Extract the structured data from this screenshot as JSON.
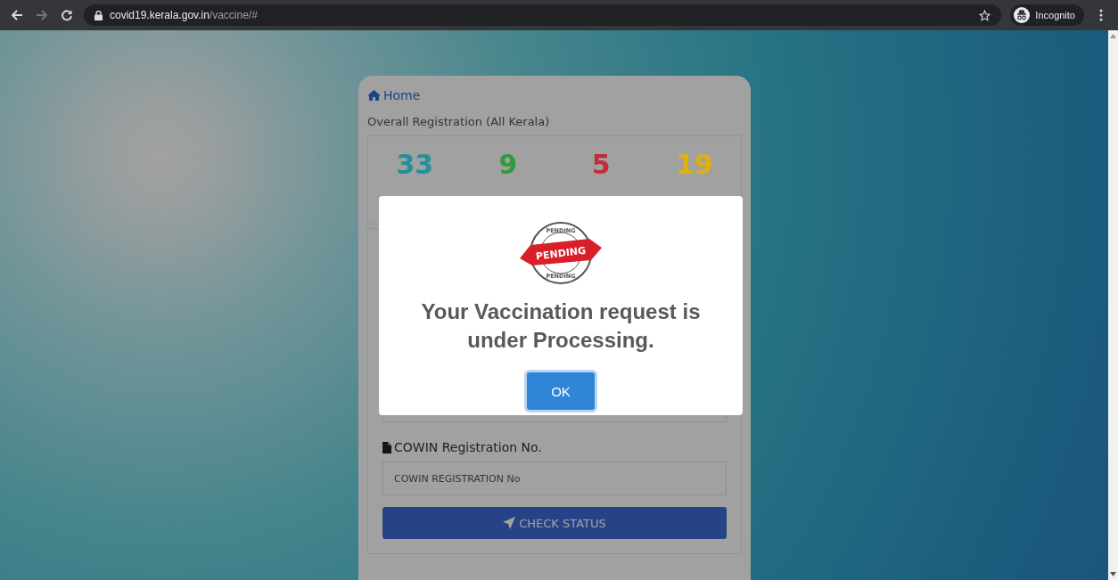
{
  "browser": {
    "url_host": "covid19.kerala.gov.in",
    "url_path": "/vaccine/#",
    "profile_label": "Incognito",
    "forward_disabled": true
  },
  "card": {
    "home_link": "Home",
    "section_title": "Overall Registration (All Kerala)",
    "stats": [
      {
        "value": "33",
        "color": "#23909a"
      },
      {
        "value": "9",
        "color": "#2f9b3b"
      },
      {
        "value": "5",
        "color": "#c22b3a"
      },
      {
        "value": "19",
        "color": "#e0b00e"
      }
    ],
    "field_label": "COWIN Registration No.",
    "field_placeholder": "COWIN REGISTRATION No",
    "submit_button": "CHECK STATUS"
  },
  "dialog": {
    "stamp": {
      "ribbon": "PENDING",
      "ring_top": "PENDING",
      "ring_bottom": "PENDING"
    },
    "message": "Your Vaccination request is under Processing.",
    "confirm_button": "OK"
  }
}
